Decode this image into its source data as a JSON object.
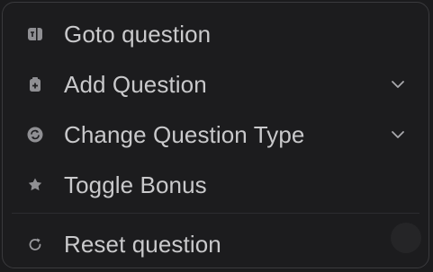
{
  "menu": {
    "items": [
      {
        "label": "Goto question",
        "icon": "goto-question-icon",
        "has_submenu": false
      },
      {
        "label": "Add Question",
        "icon": "clipboard-plus-icon",
        "has_submenu": true
      },
      {
        "label": "Change Question Type",
        "icon": "swap-circle-icon",
        "has_submenu": true
      },
      {
        "label": "Toggle Bonus",
        "icon": "star-badge-icon",
        "has_submenu": false
      },
      {
        "label": "Reset question",
        "icon": "reset-icon",
        "has_submenu": false
      }
    ]
  },
  "colors": {
    "background": "#1c1c1e",
    "border": "#3a3a3d",
    "text": "#c9c9cb",
    "icon": "#9a9a9e"
  }
}
